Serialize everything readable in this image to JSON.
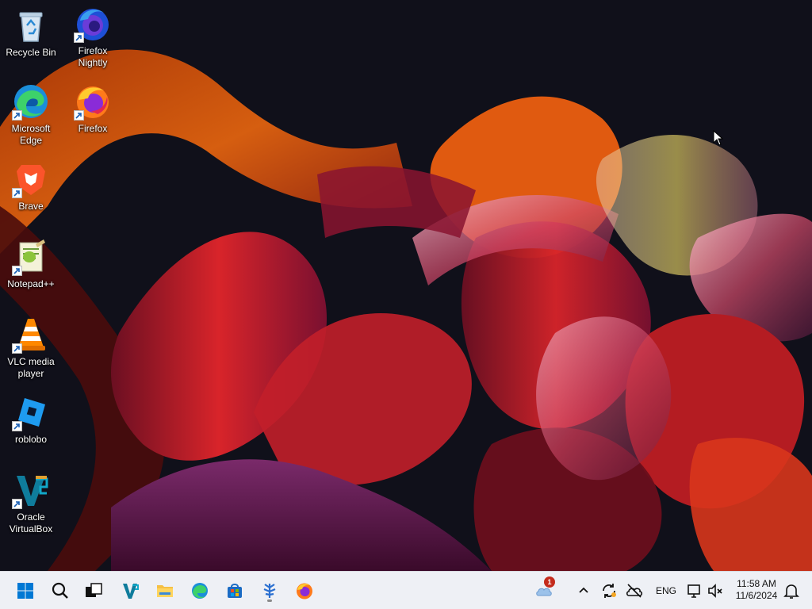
{
  "desktop": {
    "icons": [
      {
        "label": "Recycle Bin",
        "icon": "recycle-bin-icon",
        "shortcut": false
      },
      {
        "label": "Firefox\nNightly",
        "icon": "firefox-nightly-icon",
        "shortcut": true
      },
      {
        "label": "Microsoft\nEdge",
        "icon": "edge-icon",
        "shortcut": true
      },
      {
        "label": "Firefox",
        "icon": "firefox-icon",
        "shortcut": true
      },
      {
        "label": "Brave",
        "icon": "brave-icon",
        "shortcut": true
      },
      {
        "label": "Notepad++",
        "icon": "notepad-plus-plus-icon",
        "shortcut": true
      },
      {
        "label": "VLC media\nplayer",
        "icon": "vlc-icon",
        "shortcut": true
      },
      {
        "label": "roblobo",
        "icon": "roblox-icon",
        "shortcut": true
      },
      {
        "label": "Oracle\nVirtualBox",
        "icon": "virtualbox-icon",
        "shortcut": true
      }
    ]
  },
  "taskbar": {
    "pinned": [
      {
        "name": "start-button",
        "icon": "windows-start-icon"
      },
      {
        "name": "search-button",
        "icon": "search-icon"
      },
      {
        "name": "task-view-button",
        "icon": "task-view-icon"
      },
      {
        "name": "virtualbox-taskbar-button",
        "icon": "virtualbox-icon"
      },
      {
        "name": "file-explorer-button",
        "icon": "folder-icon"
      },
      {
        "name": "edge-taskbar-button",
        "icon": "edge-icon"
      },
      {
        "name": "microsoft-store-button",
        "icon": "store-icon"
      },
      {
        "name": "app-taskbar-button",
        "icon": "tree-app-icon"
      },
      {
        "name": "firefox-taskbar-button",
        "icon": "firefox-icon"
      }
    ],
    "tray": {
      "weather_badge": "1",
      "language": "ENG",
      "time": "11:58 AM",
      "date": "11/6/2024"
    }
  },
  "colors": {
    "taskbar_bg": "#eef0f5",
    "accent_blue": "#0078d4",
    "badge_red": "#c42b1c"
  }
}
